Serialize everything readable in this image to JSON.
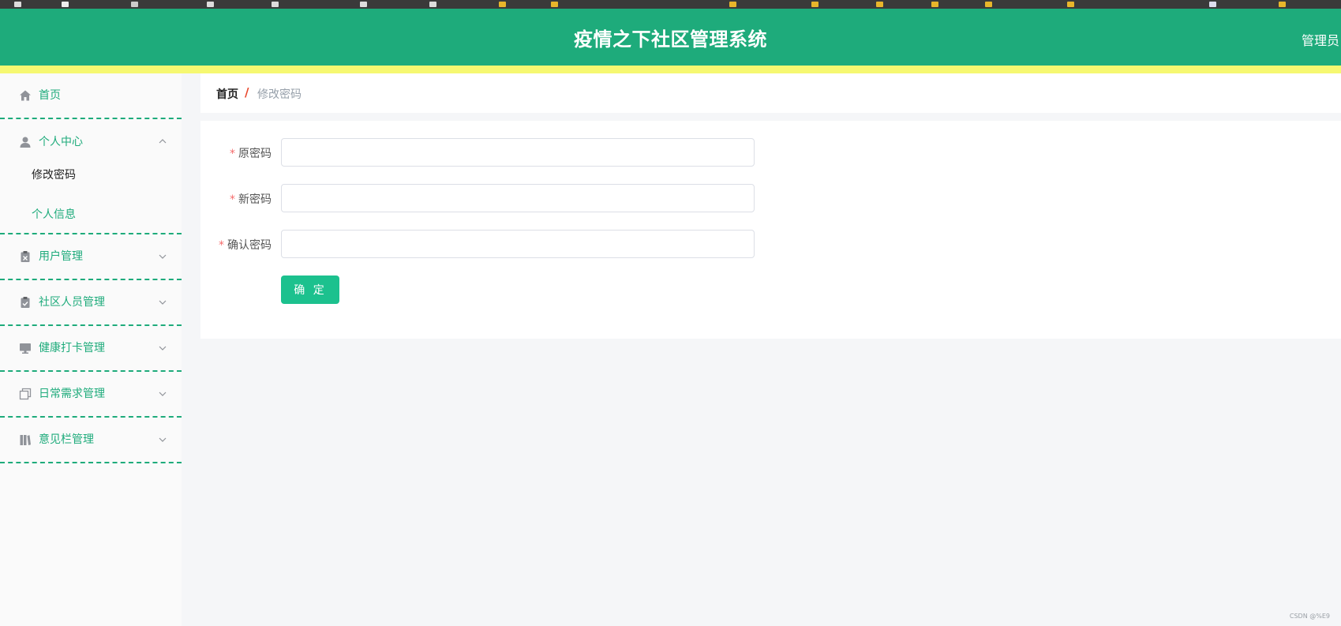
{
  "header": {
    "title": "疫情之下社区管理系统",
    "user": "管理员"
  },
  "sidebar": {
    "home": "首页",
    "personal_center": {
      "label": "个人中心",
      "children": [
        "修改密码",
        "个人信息"
      ]
    },
    "items": [
      "用户管理",
      "社区人员管理",
      "健康打卡管理",
      "日常需求管理",
      "意见栏管理"
    ]
  },
  "breadcrumb": {
    "home": "首页",
    "separator": "/",
    "current": "修改密码"
  },
  "form": {
    "required_mark": "*",
    "fields": [
      {
        "label": "原密码",
        "value": ""
      },
      {
        "label": "新密码",
        "value": ""
      },
      {
        "label": "确认密码",
        "value": ""
      }
    ],
    "submit_label": "确 定"
  },
  "watermark": "CSDN @%E9",
  "colors": {
    "brand": "#1eab7b",
    "accent_bar": "#f6f871",
    "button": "#1cc18e",
    "required": "#f56c6c"
  }
}
